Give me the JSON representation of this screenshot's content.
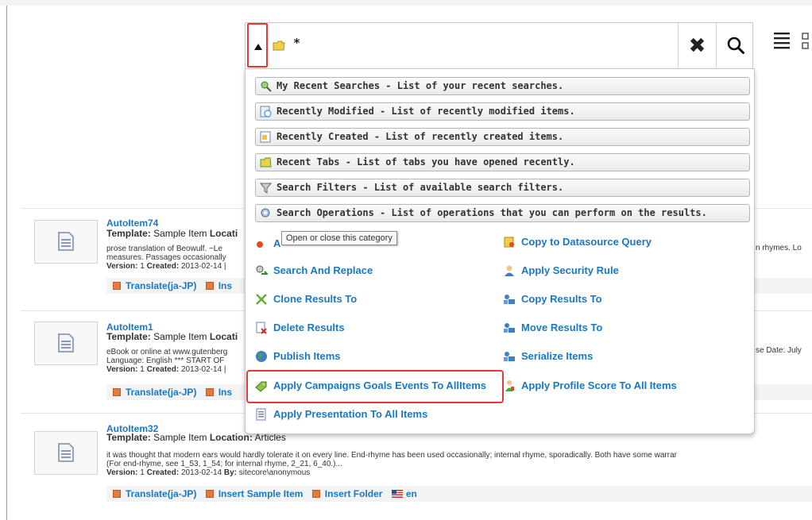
{
  "search": {
    "query": "*"
  },
  "dropdown": {
    "categories": [
      {
        "label": "My Recent Searches - List of your recent searches.",
        "icon": "recent-searches-icon"
      },
      {
        "label": "Recently Modified - List of recently modified items.",
        "icon": "recently-modified-icon"
      },
      {
        "label": "Recently Created - List of recently created items.",
        "icon": "recently-created-icon"
      },
      {
        "label": "Recent Tabs - List of tabs you have opened recently.",
        "icon": "recent-tabs-icon"
      },
      {
        "label": "Search Filters - List of available search filters.",
        "icon": "filter-icon"
      },
      {
        "label": "Search Operations - List of operations that you can perform on the results.",
        "icon": "search-operations-icon"
      }
    ],
    "operations_left": [
      {
        "label": "A"
      },
      {
        "label": "Search And Replace"
      },
      {
        "label": "Clone Results To"
      },
      {
        "label": "Delete Results"
      },
      {
        "label": "Publish Items"
      },
      {
        "label": "Apply Campaigns Goals Events To AllItems"
      },
      {
        "label": "Apply Presentation To All Items"
      }
    ],
    "operations_right": [
      {
        "label": "Copy to Datasource Query"
      },
      {
        "label": "Apply Security Rule"
      },
      {
        "label": "Copy Results To"
      },
      {
        "label": "Move Results To"
      },
      {
        "label": "Serialize Items"
      },
      {
        "label": "Apply Profile Score To All Items"
      }
    ],
    "tooltip": "Open or close this category"
  },
  "results": [
    {
      "title": "AutoItem74",
      "template_label": "Template:",
      "template": " Sample Item ",
      "location_label": "Locati",
      "snippet1": "prose translation of Beowulf. ~Le",
      "snippet2": "measures. Passages occasionally",
      "version_label": "Version:",
      "version": " 1 ",
      "created_label": "Created:",
      "created": " 2013-02-14 |",
      "right_fragment": "n rhymes. Lo",
      "actions": [
        "Translate(ja-JP)",
        "Ins"
      ]
    },
    {
      "title": "AutoItem1",
      "template_label": "Template:",
      "template": " Sample Item ",
      "location_label": "Locati",
      "snippet1": "eBook or online at www.gutenberg",
      "snippet2": "Language: English *** START OF",
      "version_label": "Version:",
      "version": " 1 ",
      "created_label": "Created:",
      "created": " 2013-02-14 |",
      "right_fragment": "se Date: July",
      "actions": [
        "Translate(ja-JP)",
        "Ins"
      ]
    },
    {
      "title": "AutoItem32",
      "template_label": "Template:",
      "template": " Sample Item ",
      "location_label": "Location:",
      "location": " Articles",
      "snippet1": "it was thought that modern ears would hardly tolerate it on every line. End-rhyme has been used occasionally; internal rhyme, sporadically. Both have some warrar",
      "snippet2": "(For end-rhyme, see 1_53, 1_54; for internal rhyme, 2_21, 6_40.)...",
      "version_label": "Version:",
      "version": " 1 ",
      "created_label": "Created:",
      "created": " 2013-02-14 ",
      "by_label": "By:",
      "by": " sitecore\\anonymous",
      "actions": [
        "Translate(ja-JP)",
        "Insert Sample Item",
        "Insert Folder"
      ],
      "language": "en"
    }
  ],
  "colors": {
    "link": "#1a78c2",
    "highlight": "#e53935"
  }
}
